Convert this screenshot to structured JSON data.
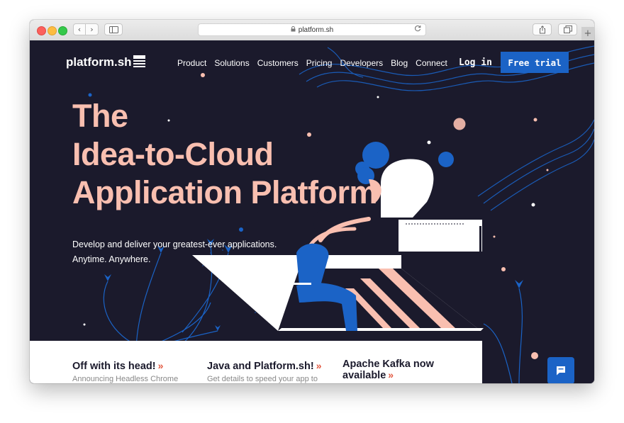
{
  "browser": {
    "url": "platform.sh",
    "back_label": "‹",
    "forward_label": "›",
    "new_tab_label": "+"
  },
  "site": {
    "logo_text": "platform.sh",
    "nav": [
      "Product",
      "Solutions",
      "Customers",
      "Pricing",
      "Developers",
      "Blog",
      "Connect"
    ],
    "login_label": "Log in",
    "cta_label": "Free trial"
  },
  "hero": {
    "title_lines": [
      "The",
      "Idea-to-Cloud",
      "Application Platform"
    ],
    "subtitle_lines": [
      "Develop and deliver your greatest-ever applications.",
      "Anytime. Anywhere."
    ]
  },
  "cards": [
    {
      "title": "Off with its head!",
      "arrow": "»",
      "snippet": "Announcing Headless Chrome"
    },
    {
      "title": "Java and Platform.sh!",
      "arrow": "»",
      "snippet": "Get details to speed your app to"
    },
    {
      "title_line1": "Apache Kafka now",
      "title_line2": "available",
      "arrow": "»"
    }
  ],
  "colors": {
    "background": "#1b1a2c",
    "accent_pink": "#f9bfb0",
    "brand_blue": "#1b63c6",
    "arrow_red": "#e2563e"
  },
  "icons": {
    "chat": "chat-bubble-icon",
    "lock": "lock-icon",
    "reload": "reload-icon",
    "share": "share-icon",
    "tabs": "tabs-icon",
    "sidebar": "sidebar-icon"
  }
}
